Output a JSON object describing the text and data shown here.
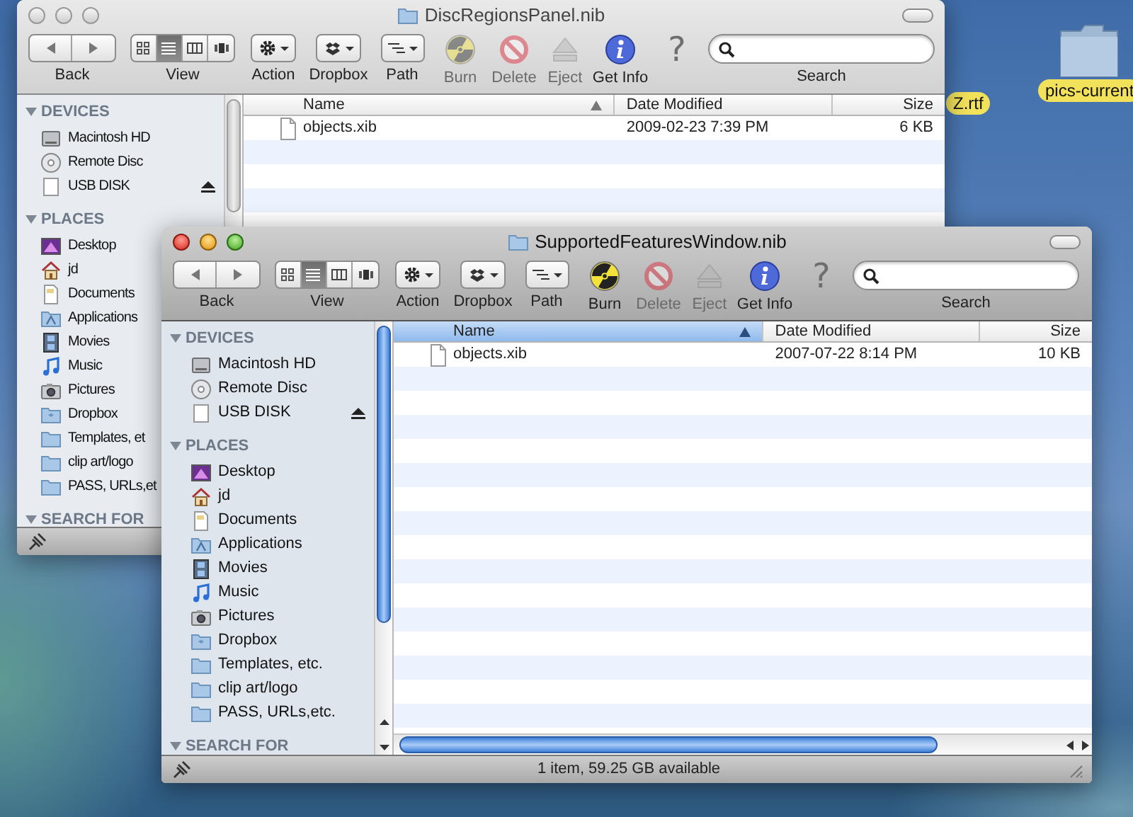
{
  "desktop_items": [
    {
      "label": "Z.rtf",
      "color": "#f1e15b"
    },
    {
      "label": "pics-current",
      "color": "#f1e15b",
      "kind": "folder"
    }
  ],
  "windows": [
    {
      "title": "DiscRegionsPanel.nib",
      "active": false,
      "toolbar": [
        {
          "kind": "nav",
          "label": "Back"
        },
        {
          "kind": "view",
          "label": "View",
          "modes": [
            {
              "selected": false
            },
            {
              "selected": true
            },
            {
              "selected": false
            },
            {
              "selected": false
            }
          ]
        },
        {
          "kind": "action",
          "label": "Action"
        },
        {
          "kind": "dropbox",
          "label": "Dropbox"
        },
        {
          "kind": "path",
          "label": "Path"
        },
        {
          "kind": "burn",
          "label": "Burn",
          "disabled": true
        },
        {
          "kind": "delete",
          "label": "Delete",
          "disabled": true
        },
        {
          "kind": "eject",
          "label": "Eject",
          "disabled": true
        },
        {
          "kind": "info",
          "label": "Get Info",
          "disabled": false
        },
        {
          "kind": "help",
          "glyph": "?"
        },
        {
          "kind": "search",
          "label": "Search"
        }
      ],
      "sidebar": [
        {
          "title": "DEVICES",
          "expanded": true,
          "items": [
            {
              "label": "Macintosh HD",
              "kind": "hd"
            },
            {
              "label": "Remote Disc",
              "kind": "disc"
            },
            {
              "label": "USB DISK",
              "kind": "usb",
              "eject": true
            }
          ]
        },
        {
          "title": "PLACES",
          "expanded": true,
          "items": [
            {
              "label": "Desktop",
              "kind": "desktop"
            },
            {
              "label": "jd",
              "kind": "home"
            },
            {
              "label": "Documents",
              "kind": "documents"
            },
            {
              "label": "Applications",
              "kind": "applications"
            },
            {
              "label": "Movies",
              "kind": "movies"
            },
            {
              "label": "Music",
              "kind": "music"
            },
            {
              "label": "Pictures",
              "kind": "pictures"
            },
            {
              "label": "Dropbox",
              "kind": "dropbox"
            },
            {
              "label": "Templates, et",
              "kind": "folder"
            },
            {
              "label": "clip art/logo",
              "kind": "folder"
            },
            {
              "label": "PASS, URLs,et",
              "kind": "folder"
            }
          ]
        },
        {
          "title": "SEARCH FOR",
          "expanded": true
        }
      ],
      "columns": [
        {
          "label": "Name",
          "sorted": true
        },
        {
          "label": "Date Modified",
          "sorted": false
        },
        {
          "label": "Size",
          "sorted": false
        }
      ],
      "rows": [
        {
          "name": "objects.xib",
          "date": "2009-02-23 7:39 PM",
          "size": "6 KB"
        }
      ]
    },
    {
      "title": "SupportedFeaturesWindow.nib",
      "active": true,
      "toolbar": [
        {
          "kind": "nav",
          "label": "Back"
        },
        {
          "kind": "view",
          "label": "View",
          "modes": [
            {
              "selected": false
            },
            {
              "selected": true
            },
            {
              "selected": false
            },
            {
              "selected": false
            }
          ]
        },
        {
          "kind": "action",
          "label": "Action"
        },
        {
          "kind": "dropbox",
          "label": "Dropbox"
        },
        {
          "kind": "path",
          "label": "Path"
        },
        {
          "kind": "burn",
          "label": "Burn",
          "disabled": false
        },
        {
          "kind": "delete",
          "label": "Delete",
          "disabled": true
        },
        {
          "kind": "eject",
          "label": "Eject",
          "disabled": true
        },
        {
          "kind": "info",
          "label": "Get Info",
          "disabled": false
        },
        {
          "kind": "help",
          "glyph": "?"
        },
        {
          "kind": "search",
          "label": "Search"
        }
      ],
      "sidebar": [
        {
          "title": "DEVICES",
          "expanded": true,
          "items": [
            {
              "label": "Macintosh HD",
              "kind": "hd"
            },
            {
              "label": "Remote Disc",
              "kind": "disc"
            },
            {
              "label": "USB DISK",
              "kind": "usb",
              "eject": true
            }
          ]
        },
        {
          "title": "PLACES",
          "expanded": true,
          "items": [
            {
              "label": "Desktop",
              "kind": "desktop"
            },
            {
              "label": "jd",
              "kind": "home"
            },
            {
              "label": "Documents",
              "kind": "documents"
            },
            {
              "label": "Applications",
              "kind": "applications"
            },
            {
              "label": "Movies",
              "kind": "movies"
            },
            {
              "label": "Music",
              "kind": "music"
            },
            {
              "label": "Pictures",
              "kind": "pictures"
            },
            {
              "label": "Dropbox",
              "kind": "dropbox"
            },
            {
              "label": "Templates, etc.",
              "kind": "folder"
            },
            {
              "label": "clip art/logo",
              "kind": "folder"
            },
            {
              "label": "PASS, URLs,etc.",
              "kind": "folder"
            }
          ]
        },
        {
          "title": "SEARCH FOR",
          "expanded": true
        }
      ],
      "columns": [
        {
          "label": "Name",
          "sorted": true
        },
        {
          "label": "Date Modified",
          "sorted": false
        },
        {
          "label": "Size",
          "sorted": false
        }
      ],
      "rows": [
        {
          "name": "objects.xib",
          "date": "2007-07-22 8:14 PM",
          "size": "10 KB"
        }
      ],
      "status": "1 item, 59.25 GB available"
    }
  ]
}
